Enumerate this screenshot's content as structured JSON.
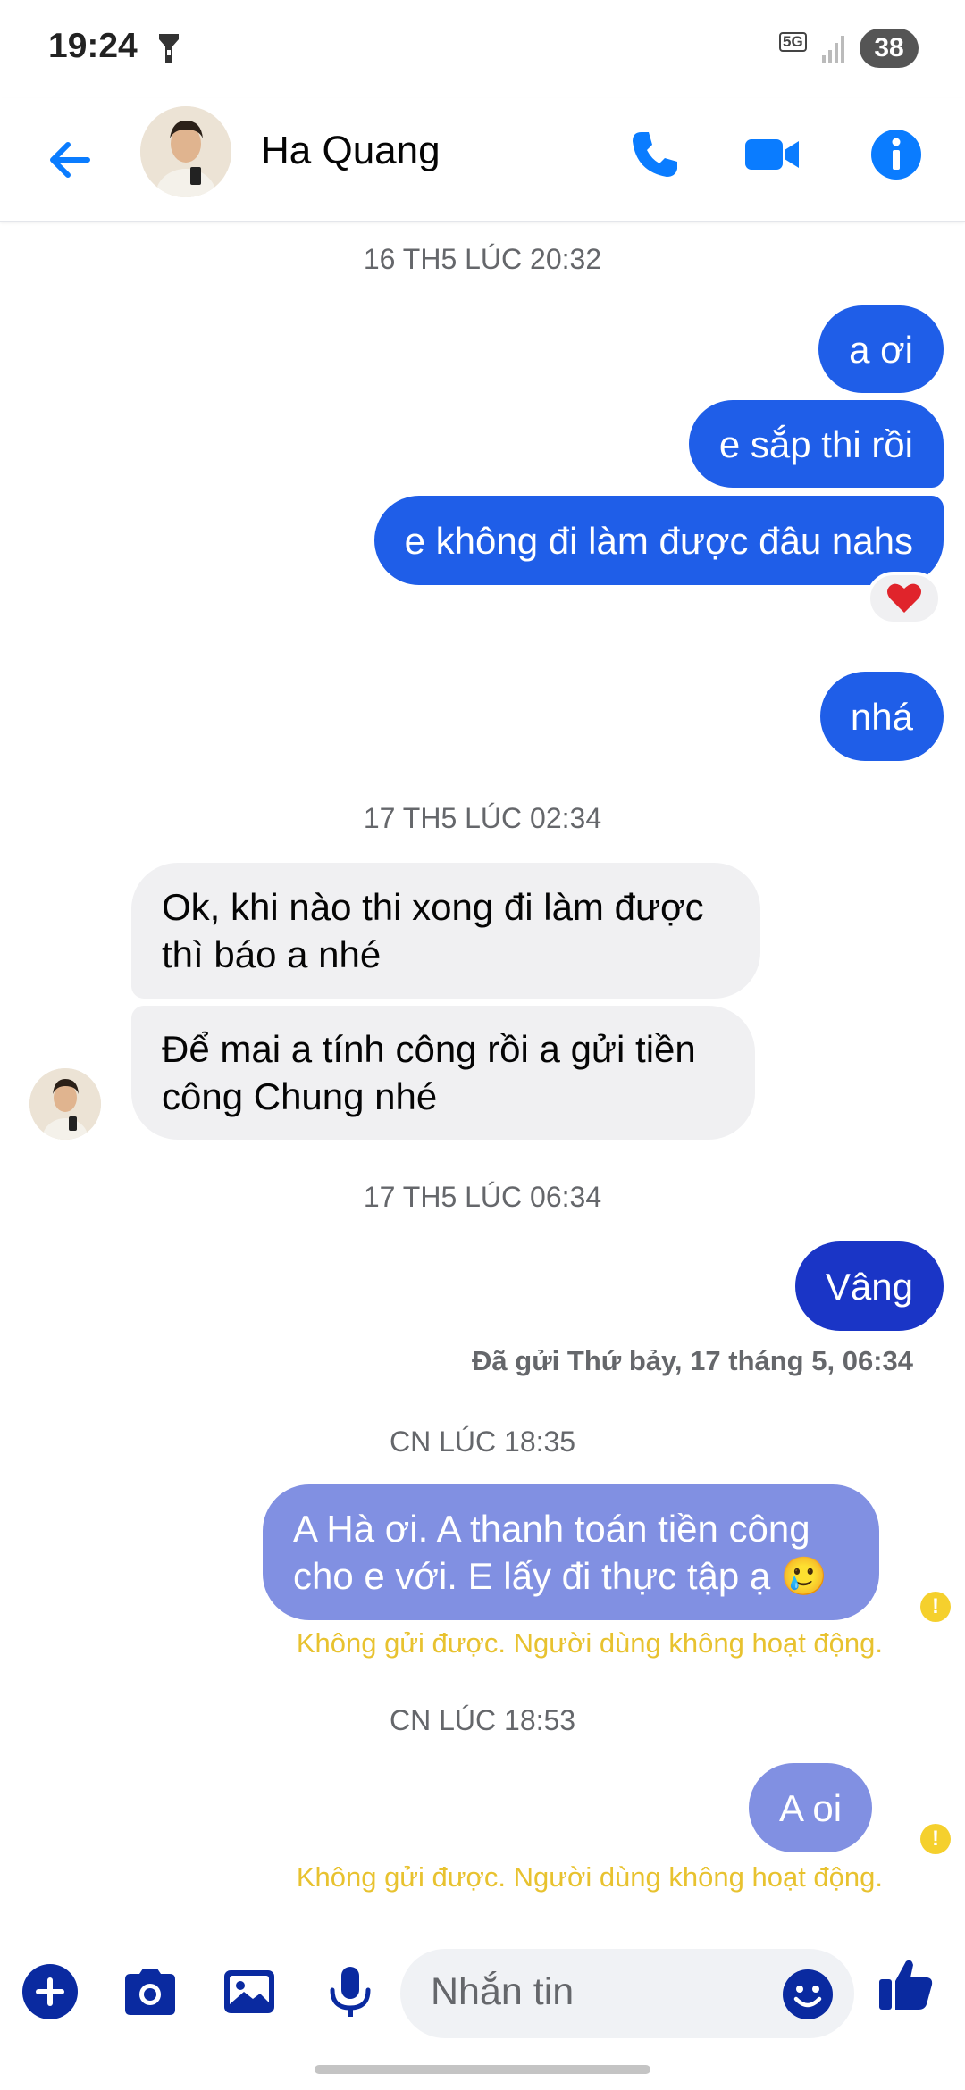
{
  "status_bar": {
    "time": "19:24",
    "network": "5G",
    "battery": "38"
  },
  "header": {
    "contact_name": "Ha Quang"
  },
  "colors": {
    "accent": "#0a7cff",
    "outgoing": "#1f5ee8",
    "outgoing_last": "#1a35c6",
    "failed_bubble": "#8190e2",
    "warning": "#e8c22f"
  },
  "messages": {
    "ts1": "16 TH5 LÚC 20:32",
    "m1": "a ơi",
    "m2": "e sắp thi rồi",
    "m3": "e không đi làm được đâu nahs",
    "m3_reaction": "❤️",
    "m4": "nhá",
    "ts2": "17 TH5 LÚC 02:34",
    "in1_line1": "Ok, khi nào thi xong đi làm được",
    "in1_line2": "thì báo a nhé",
    "in2_line1": "Để mai a tính công rồi a gửi tiền",
    "in2_line2": "công Chung nhé",
    "ts3": "17 TH5 LÚC 06:34",
    "m5": "Vâng",
    "sent_status": "Đã gửi Thứ bảy, 17 tháng 5, 06:34",
    "ts4": "CN LÚC 18:35",
    "m6_line1": "A Hà ơi. A thanh toán tiền công",
    "m6_line2": "cho e với. E lấy đi thực tập ạ",
    "m6_emoji": "🥲",
    "fail1": "Không gửi được. Người dùng không hoạt động.",
    "ts5": "CN LÚC 18:53",
    "m7": "A oi",
    "fail2": "Không gửi được. Người dùng không hoạt động."
  },
  "composer": {
    "placeholder": "Nhắn tin"
  }
}
